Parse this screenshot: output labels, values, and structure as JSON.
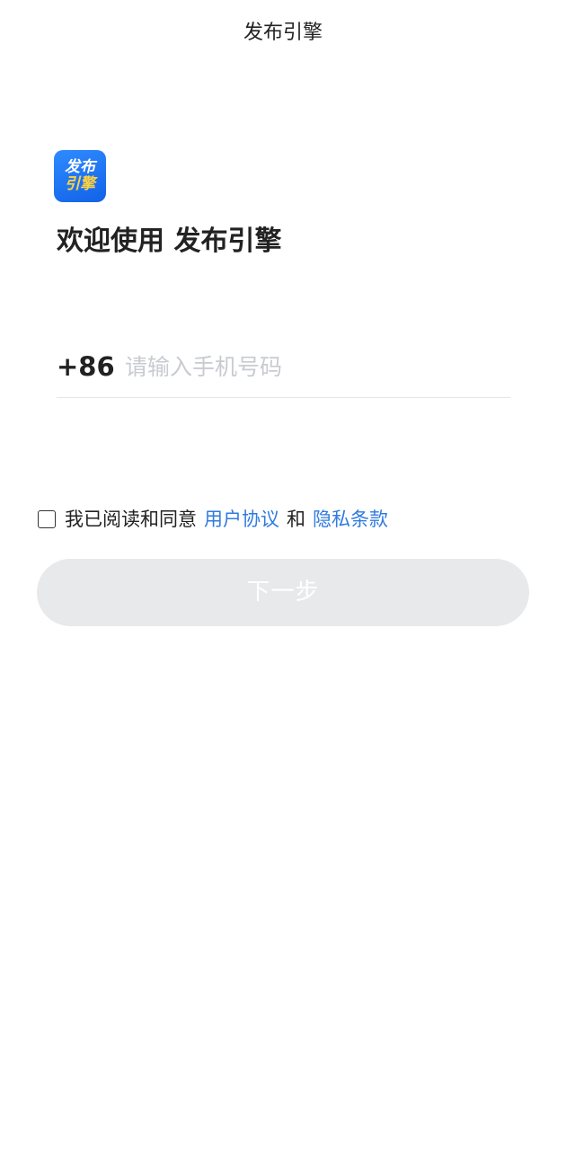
{
  "nav": {
    "title": "发布引擎"
  },
  "logo": {
    "line1": "发布",
    "line2": "引擎",
    "bg_color": "#1a6ff0",
    "accent_color": "#ffd23f"
  },
  "welcome": {
    "text": "欢迎使用 发布引擎"
  },
  "phone": {
    "country_code": "+86",
    "placeholder": "请输入手机号码",
    "value": ""
  },
  "agreement": {
    "checked": false,
    "prefix": "我已阅读和同意",
    "terms_link": "用户协议",
    "conjunction": "和",
    "privacy_link": "隐私条款",
    "link_color": "#2f7be0"
  },
  "next_button": {
    "label": "下一步",
    "enabled": false
  }
}
